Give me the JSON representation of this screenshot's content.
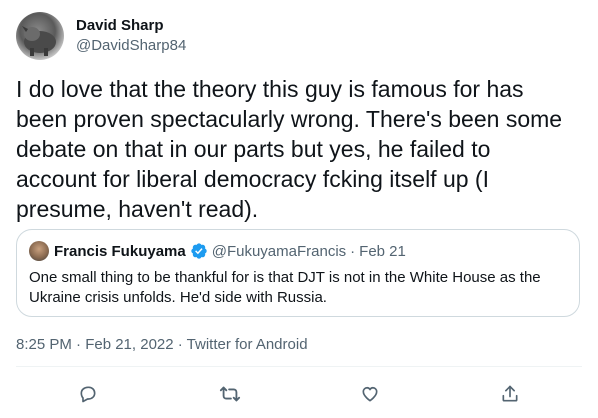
{
  "author": {
    "display_name": "David Sharp",
    "handle": "@DavidSharp84"
  },
  "tweet": {
    "text": "I do love that the theory this guy is famous for has\nbeen proven spectacularly wrong. There's been some\ndebate on that in our parts but yes, he failed to\naccount for liberal democracy fcking itself up (I\npresume, haven't read)."
  },
  "quoted_tweet": {
    "display_name": "Francis Fukuyama",
    "handle": "@FukuyamaFrancis",
    "separator": "·",
    "date": "Feb 21",
    "text": "One small thing to be thankful for is that DJT is not in the White House as the Ukraine crisis unfolds. He'd side with Russia."
  },
  "meta": {
    "timestamp": "8:25 PM · Feb 21, 2022 · Twitter for Android"
  },
  "icons": {
    "reply": "reply-icon",
    "retweet": "retweet-icon",
    "like": "like-icon",
    "share": "share-icon",
    "verified": "verified-badge-icon"
  },
  "colors": {
    "verified": "#1d9bf0",
    "icon": "#536471",
    "border": "#cfd9de"
  }
}
